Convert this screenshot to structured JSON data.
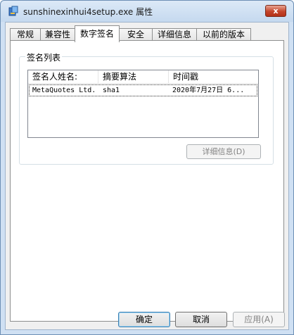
{
  "window": {
    "title": "sunshinexinhui4setup.exe 属性",
    "close_label": "x"
  },
  "tabs": [
    {
      "label": "常规"
    },
    {
      "label": "兼容性"
    },
    {
      "label": "数字签名",
      "active": true
    },
    {
      "label": "安全"
    },
    {
      "label": "详细信息"
    },
    {
      "label": "以前的版本"
    }
  ],
  "signature_group": {
    "label": "签名列表",
    "columns": [
      "签名人姓名:",
      "摘要算法",
      "时间戳"
    ],
    "rows": [
      {
        "signer": "MetaQuotes Ltd.",
        "digest": "sha1",
        "timestamp": "2020年7月27日 6..."
      }
    ],
    "details_button": "详细信息(D)"
  },
  "buttons": {
    "ok": "确定",
    "cancel": "取消",
    "apply": "应用(A)"
  }
}
